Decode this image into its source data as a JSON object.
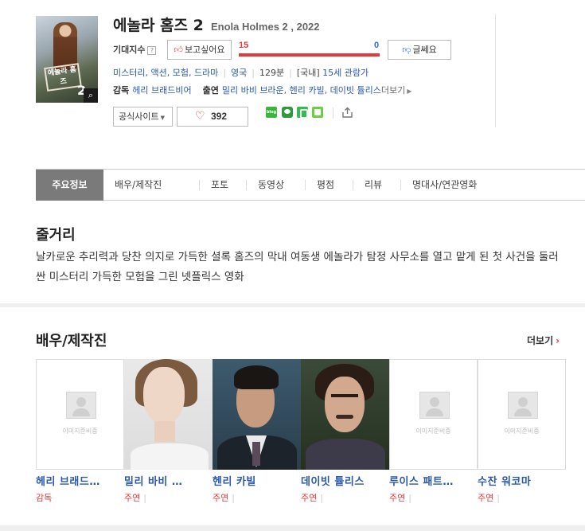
{
  "movie": {
    "title_ko": "에놀라 홈즈 2",
    "title_en": "Enola Holmes 2 , 2022",
    "poster_text": "에놀라 홈즈",
    "poster_num": "2",
    "expect_label": "기대지수",
    "help_glyph": "?",
    "want_label": "보고싶어요",
    "meh_label": "글쎄요",
    "want_count": "15",
    "meh_count": "0",
    "want_ratio": 1.0,
    "genres": "미스터리, 액션, 모험, 드라마",
    "country": "영국",
    "runtime": "129분",
    "rating_prefix": "[국내]",
    "rating": "15세 관람가",
    "director_label": "감독",
    "director": "헤리 브래드비어",
    "cast_label": "출연",
    "cast_line": "밀리 바비 브라운, 헨리 카빌, 데이빗 튤리스",
    "cast_more": "더보기",
    "site_label": "공식사이트",
    "like_count": "392",
    "blog_label": "blog"
  },
  "tabs": [
    {
      "label": "주요정보"
    },
    {
      "label": "배우/제작진"
    },
    {
      "label": "포토"
    },
    {
      "label": "동영상"
    },
    {
      "label": "평점"
    },
    {
      "label": "리뷰"
    },
    {
      "label": "명대사/연관영화"
    }
  ],
  "synopsis": {
    "title": "줄거리",
    "text": "날카로운 추리력과 당찬 의지로 가득한 셜록 홈즈의 막내 여동생 에놀라가 탐정 사무소를 열고 맡게 된 첫 사건을 둘러싼 미스터리 가득한 모험을 그린 넷플릭스 영화"
  },
  "cast_section": {
    "title": "배우/제작진",
    "more_label": "더보기",
    "placeholder_text": "이미지준비중",
    "members": [
      {
        "name": "헤리 브래드…",
        "role": "감독"
      },
      {
        "name": "밀리 바비 …",
        "role": "주연"
      },
      {
        "name": "헨리 카빌",
        "role": "주연"
      },
      {
        "name": "데이빗 튤리스",
        "role": "주연"
      },
      {
        "name": "루이스 패트…",
        "role": "주연"
      },
      {
        "name": "수잔 워코마",
        "role": "주연"
      }
    ]
  },
  "colors": {
    "accent_red": "#e5383b",
    "link_blue": "#2b59a6",
    "score_blue": "#2e6dc9",
    "tab_active": "#7a7a7a"
  }
}
